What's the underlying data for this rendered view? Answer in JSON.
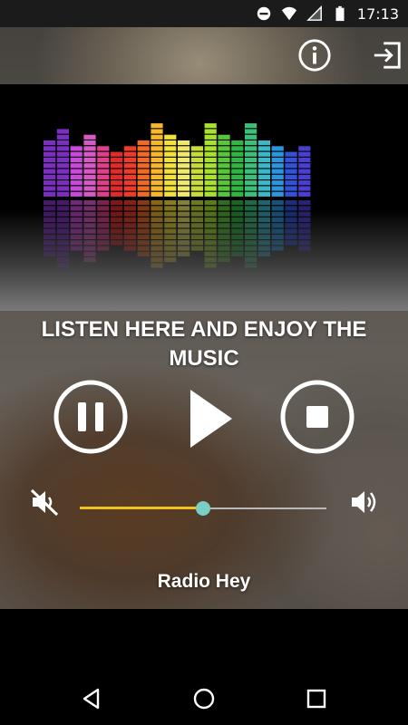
{
  "status_bar": {
    "time": "17:13"
  },
  "player": {
    "heading": "LISTEN HERE AND ENJOY THE MUSIC",
    "station_name": "Radio Hey",
    "volume_level": 0.5
  },
  "colors": {
    "slider_fill": "#f1c21b",
    "slider_thumb": "#79cfc3",
    "equalizer": [
      "#7b2fbf",
      "#7b2fbf",
      "#c84ad8",
      "#d65ac4",
      "#e03f8a",
      "#e02b2b",
      "#ee3b2b",
      "#f06a23",
      "#f7b82b",
      "#f4e13a",
      "#f0e96b",
      "#c8dc3a",
      "#a8e12e",
      "#58c63a",
      "#2fb743",
      "#3dbf7a",
      "#3ab8c8",
      "#2b95e0",
      "#3153d8",
      "#4a3fd0"
    ]
  },
  "icons": {
    "info": "info-circle-icon",
    "exit": "exit-icon",
    "pause": "pause-icon",
    "play": "play-icon",
    "stop": "stop-icon",
    "mute": "mute-icon",
    "volume": "volume-icon"
  }
}
